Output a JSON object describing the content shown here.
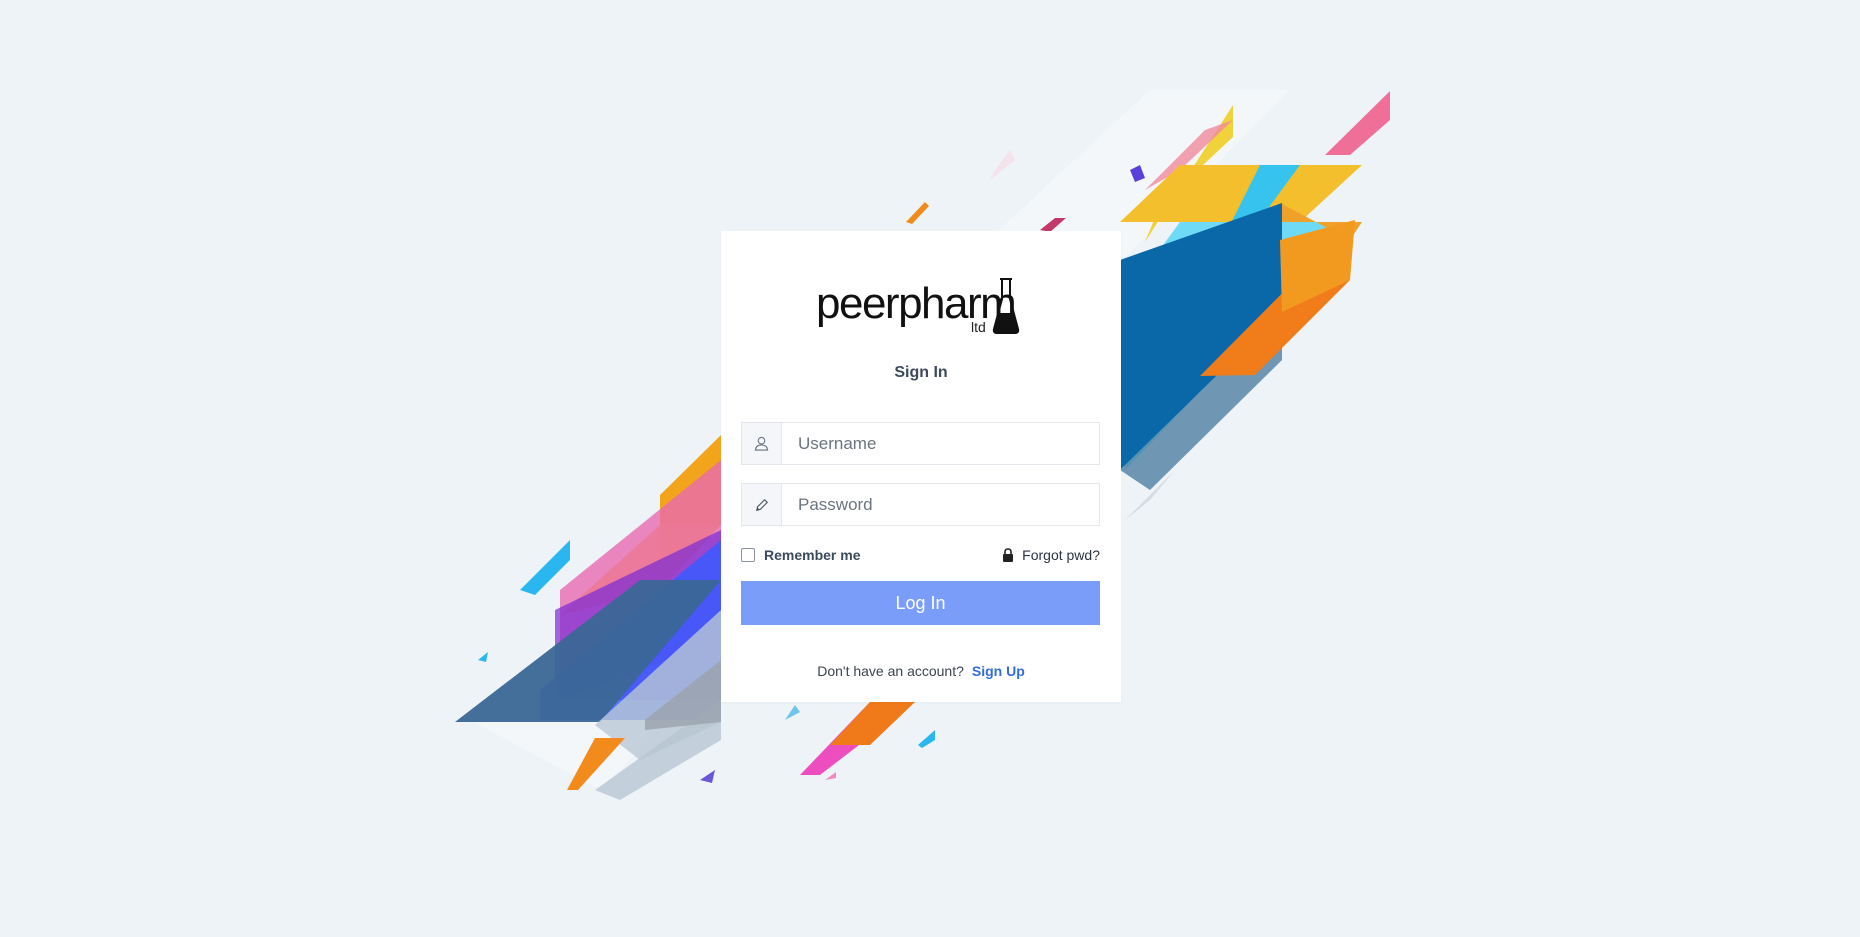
{
  "brand": {
    "name": "peerpharm",
    "suffix": "ltd"
  },
  "form": {
    "title": "Sign In",
    "username_placeholder": "Username",
    "password_placeholder": "Password",
    "remember_label": "Remember me",
    "forgot_label": "Forgot pwd?",
    "login_label": "Log In",
    "signup_prompt": "Don't have an account?",
    "signup_label": "Sign Up"
  },
  "colors": {
    "background": "#eef3f7",
    "button": "#7a9dfa",
    "link": "#2f6de1",
    "title": "#3b4a5c"
  },
  "icons": {
    "username": "user-icon",
    "password": "pencil-icon",
    "forgot": "lock-icon",
    "logo": "flask-icon"
  }
}
